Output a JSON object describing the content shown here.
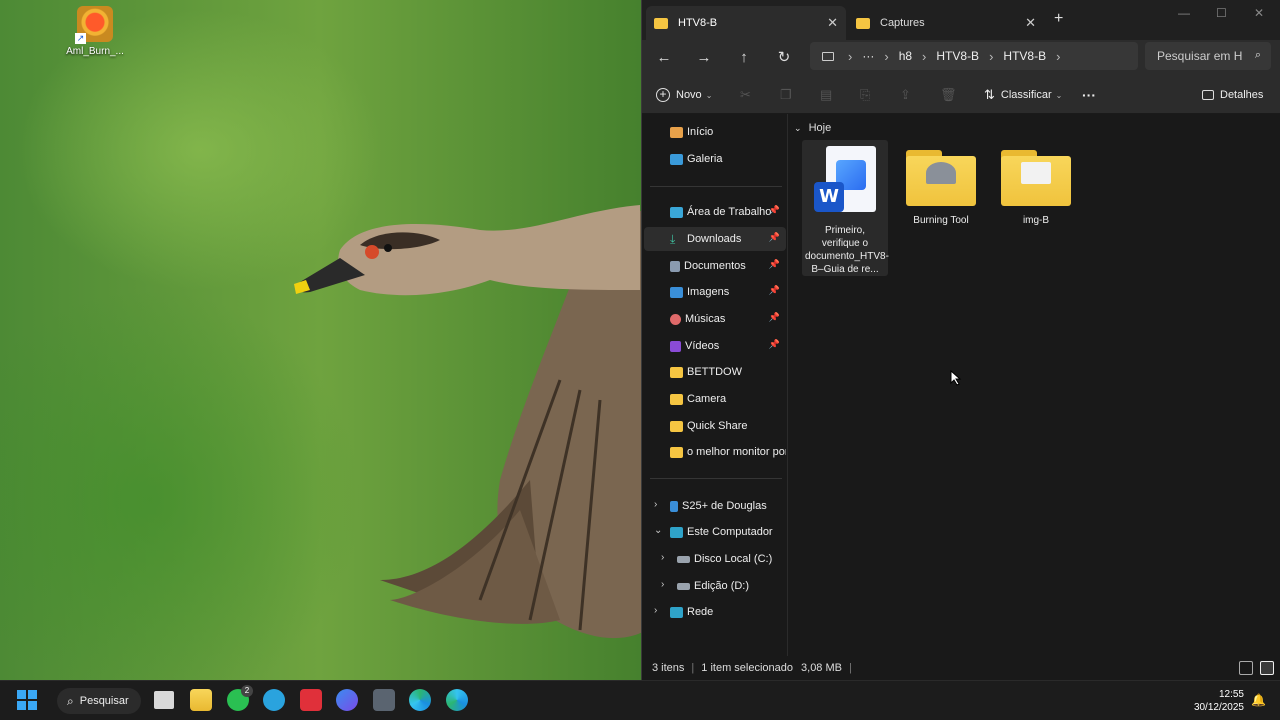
{
  "desktop": {
    "shortcut_label": "Aml_Burn_..."
  },
  "explorer": {
    "tabs": [
      {
        "label": "HTV8-B",
        "active": true
      },
      {
        "label": "Captures",
        "active": false
      }
    ],
    "new_tab": "+",
    "window_controls": {
      "minimize": "—",
      "maximize": "☐",
      "close": "✕"
    },
    "nav": {
      "back": "←",
      "forward": "→",
      "up": "↑",
      "refresh": "↻"
    },
    "breadcrumb": [
      "h8",
      "HTV8-B",
      "HTV8-B"
    ],
    "breadcrumb_more": "···",
    "search_placeholder": "Pesquisar em H",
    "toolbar": {
      "new_label": "Novo",
      "sort_label": "Classificar",
      "more": "···",
      "details_label": "Detalhes"
    },
    "sidebar": {
      "top": [
        {
          "label": "Início",
          "icon": "home-icon"
        },
        {
          "label": "Galeria",
          "icon": "gallery-icon"
        }
      ],
      "quick": [
        {
          "label": "Área de Trabalho",
          "icon": "desktop-icon",
          "pinned": true
        },
        {
          "label": "Downloads",
          "icon": "download-icon",
          "pinned": true,
          "selected": true
        },
        {
          "label": "Documentos",
          "icon": "documents-icon",
          "pinned": true
        },
        {
          "label": "Imagens",
          "icon": "pictures-icon",
          "pinned": true
        },
        {
          "label": "Músicas",
          "icon": "music-icon",
          "pinned": true
        },
        {
          "label": "Vídeos",
          "icon": "videos-icon",
          "pinned": true
        },
        {
          "label": "BETTDOW",
          "icon": "folder-icon"
        },
        {
          "label": "Camera",
          "icon": "folder-icon"
        },
        {
          "label": "Quick Share",
          "icon": "folder-icon"
        },
        {
          "label": "o melhor monitor port",
          "icon": "folder-icon"
        }
      ],
      "tree": [
        {
          "label": "S25+ de Douglas",
          "icon": "phone-icon",
          "expanded": false
        },
        {
          "label": "Este Computador",
          "icon": "computer-icon",
          "expanded": true
        },
        {
          "label": "Disco Local (C:)",
          "icon": "drive-icon",
          "expanded": false,
          "indent": true
        },
        {
          "label": "Edição (D:)",
          "icon": "drive-icon",
          "expanded": false,
          "indent": true
        },
        {
          "label": "Rede",
          "icon": "network-icon",
          "expanded": false
        }
      ]
    },
    "group_header": "Hoje",
    "files": [
      {
        "name": "Primeiro, verifique o documento_HTV8-B–Guia de re...",
        "type": "word-doc",
        "selected": true
      },
      {
        "name": "Burning Tool",
        "type": "folder"
      },
      {
        "name": "img-B",
        "type": "folder"
      }
    ],
    "status": {
      "count": "3 itens",
      "selection": "1 item selecionado",
      "size": "3,08 MB"
    }
  },
  "taskbar": {
    "search_label": "Pesquisar",
    "whatsapp_badge": "2",
    "time": "12:55",
    "date": "30/12/2025"
  }
}
